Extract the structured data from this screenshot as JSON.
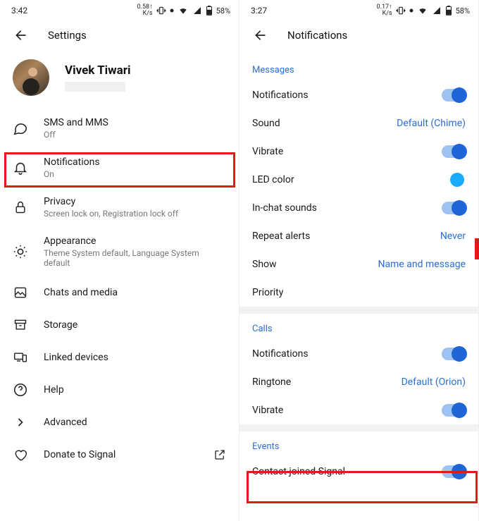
{
  "left": {
    "status": {
      "time": "3:42",
      "kb": "0.58",
      "kb_unit": "K/s",
      "battery": "58%"
    },
    "title": "Settings",
    "profile": {
      "name": "Vivek Tiwari"
    },
    "items": {
      "sms": {
        "label": "SMS and MMS",
        "sub": "Off"
      },
      "notif": {
        "label": "Notifications",
        "sub": "On"
      },
      "priv": {
        "label": "Privacy",
        "sub": "Screen lock on, Registration lock off"
      },
      "appear": {
        "label": "Appearance",
        "sub": "Theme System default, Language System default"
      },
      "chats": {
        "label": "Chats and media"
      },
      "storage": {
        "label": "Storage"
      },
      "linked": {
        "label": "Linked devices"
      },
      "help": {
        "label": "Help"
      },
      "adv": {
        "label": "Advanced"
      },
      "donate": {
        "label": "Donate to Signal"
      }
    }
  },
  "right": {
    "status": {
      "time": "3:27",
      "kb": "0.17",
      "kb_unit": "K/s",
      "battery": "58%"
    },
    "title": "Notifications",
    "sections": {
      "messages": {
        "header": "Messages"
      },
      "calls": {
        "header": "Calls"
      },
      "events": {
        "header": "Events"
      }
    },
    "msg": {
      "notif": {
        "label": "Notifications"
      },
      "sound": {
        "label": "Sound",
        "value": "Default (Chime)"
      },
      "vibrate": {
        "label": "Vibrate"
      },
      "led": {
        "label": "LED color"
      },
      "inchat": {
        "label": "In-chat sounds"
      },
      "repeat": {
        "label": "Repeat alerts",
        "value": "Never"
      },
      "show": {
        "label": "Show",
        "value": "Name and message"
      },
      "priority": {
        "label": "Priority"
      }
    },
    "calls": {
      "notif": {
        "label": "Notifications"
      },
      "ring": {
        "label": "Ringtone",
        "value": "Default (Orion)"
      },
      "vibrate": {
        "label": "Vibrate"
      }
    },
    "events": {
      "joined": {
        "label": "Contact joined Signal"
      }
    }
  }
}
